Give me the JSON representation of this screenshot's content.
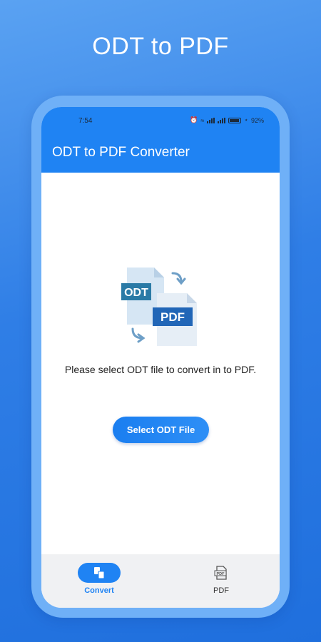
{
  "promo": {
    "title": "ODT to PDF"
  },
  "status_bar": {
    "time": "7:54",
    "battery": "92%"
  },
  "app": {
    "title": "ODT to PDF Converter"
  },
  "main": {
    "illustration": {
      "source_label": "ODT",
      "target_label": "PDF"
    },
    "prompt": "Please select ODT file to convert in to PDF.",
    "select_button": "Select ODT File"
  },
  "bottom_nav": {
    "items": [
      {
        "label": "Convert",
        "icon": "convert-icon",
        "active": true
      },
      {
        "label": "PDF",
        "icon": "pdf-file-icon",
        "active": false
      }
    ]
  },
  "colors": {
    "accent": "#1f83f3",
    "background_gradient": [
      "#5aa2f2",
      "#1f6fdd"
    ]
  }
}
